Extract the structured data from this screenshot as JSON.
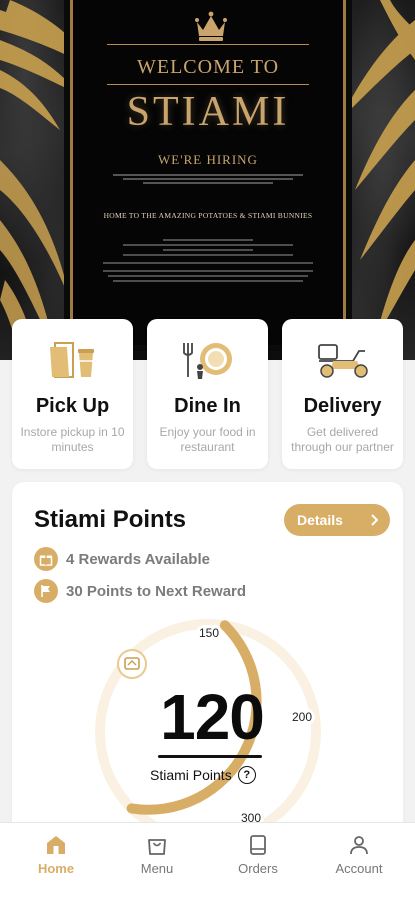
{
  "colors": {
    "accent": "#d8ae66",
    "poster_gold": "#c9a46c",
    "card_bg": "#ffffff",
    "page_bg": "#f2f2f2",
    "text_muted": "#a8a8a8"
  },
  "hero": {
    "welcome": "WELCOME TO",
    "brand": "STIAMI",
    "hiring": "WE'RE HIRING",
    "tagline": "HOME TO THE AMAZING POTATOES & STIAMI BUNNIES",
    "icons": [
      "crown-icon",
      "palm-leaf-icon"
    ]
  },
  "services": [
    {
      "title": "Pick Up",
      "subtitle": "Instore pickup in 10 minutes",
      "icon": "pickup-bag-icon"
    },
    {
      "title": "Dine In",
      "subtitle": "Enjoy your food in restaurant",
      "icon": "dine-plate-icon"
    },
    {
      "title": "Delivery",
      "subtitle": "Get delivered through our partner",
      "icon": "scooter-icon"
    }
  ],
  "points": {
    "title": "Stiami Points",
    "details_label": "Details",
    "rewards_text": "4 Rewards Available",
    "next_reward_text": "30 Points to Next Reward",
    "current_points": "120",
    "points_label": "Stiami Points",
    "help_glyph": "?",
    "gauge_ticks": [
      "150",
      "200",
      "300"
    ],
    "gauge_progress_fraction": 0.4
  },
  "nav": {
    "items": [
      {
        "label": "Home",
        "icon": "home-icon",
        "active": true
      },
      {
        "label": "Menu",
        "icon": "menu-bag-icon",
        "active": false
      },
      {
        "label": "Orders",
        "icon": "orders-book-icon",
        "active": false
      },
      {
        "label": "Account",
        "icon": "account-person-icon",
        "active": false
      }
    ]
  }
}
